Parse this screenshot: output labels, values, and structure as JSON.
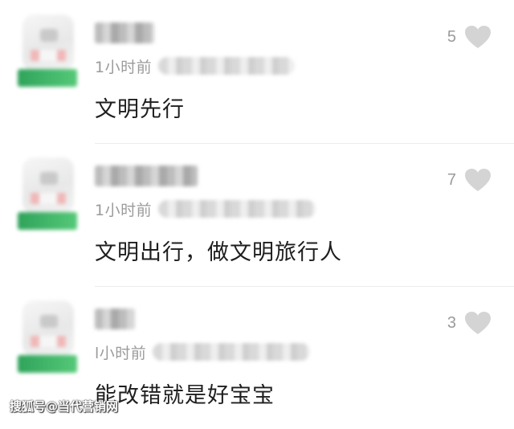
{
  "comments": [
    {
      "time": "1小时前",
      "text": "文明先行",
      "likes": "5",
      "like_icon": "heart-icon"
    },
    {
      "time": "1小时前",
      "text": "文明出行，做文明旅行人",
      "likes": "7",
      "like_icon": "heart-icon"
    },
    {
      "time": "l小时前",
      "text": "能改错就是好宝宝",
      "likes": "3",
      "like_icon": "heart-icon"
    }
  ],
  "watermark": "搜狐号@当代营销网",
  "colors": {
    "heart": "#d4d4d4",
    "secondary_text": "#9b9b9b",
    "badge": "#3fb46a"
  }
}
